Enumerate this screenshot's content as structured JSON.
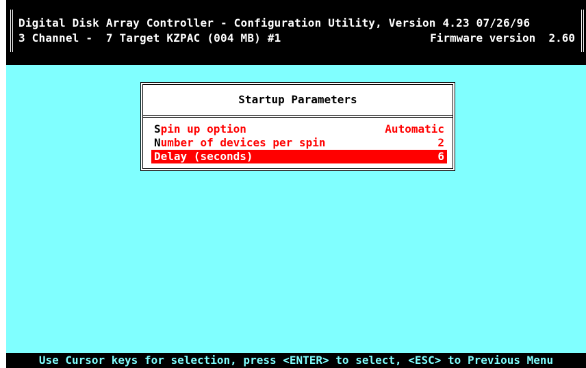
{
  "header": {
    "line1": "Digital Disk Array Controller - Configuration Utility, Version 4.23 07/26/96",
    "line2_left": "3 Channel -  7 Target KZPAC (004 MB) #1",
    "line2_right": "Firmware version  2.60"
  },
  "dialog": {
    "title": "Startup Parameters",
    "options": [
      {
        "hotkey": "S",
        "label_rest": "pin up option",
        "value": "Automatic",
        "selected": false
      },
      {
        "hotkey": "N",
        "label_rest": "umber of devices per spin",
        "value": "2",
        "selected": false
      },
      {
        "hotkey": "D",
        "label_rest": "elay (seconds)",
        "value": "6",
        "selected": true
      }
    ]
  },
  "footer": {
    "help_text": "Use Cursor keys for selection, press <ENTER> to select, <ESC> to Previous Menu"
  },
  "colors": {
    "background": "#80ffff",
    "dialog_bg": "#ffffff",
    "highlight": "#ff0000",
    "text_red": "#ff0000",
    "header_bg": "#000000"
  }
}
